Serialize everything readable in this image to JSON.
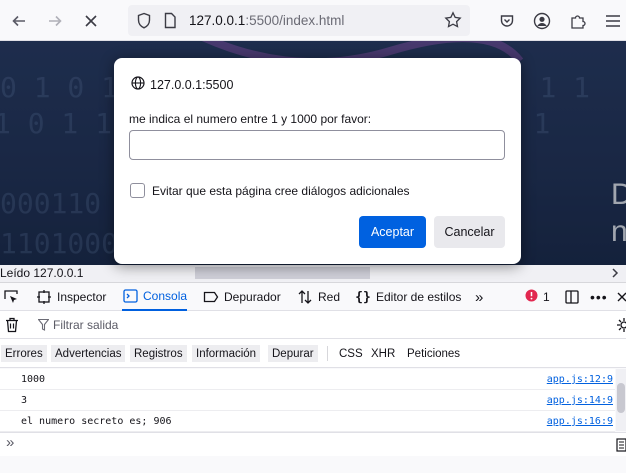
{
  "browser": {
    "url_host": "127.0.0.1",
    "url_rest": ":5500/index.html",
    "icons": [
      "back-arrow-icon",
      "forward-arrow-icon",
      "stop-loading-icon",
      "shield-icon",
      "page-info-icon",
      "star-icon",
      "pocket-icon",
      "account-icon",
      "extensions-icon",
      "menu-icon"
    ]
  },
  "page": {
    "letter_1": "D",
    "letter_2": "n",
    "status_text": "Leído 127.0.0.1"
  },
  "dialog": {
    "origin": "127.0.0.1:5500",
    "message": "me indica el numero entre 1 y 1000 por favor:",
    "input_value": "",
    "checkbox_label": "Evitar que esta página cree diálogos adicionales",
    "accept_label": "Aceptar",
    "cancel_label": "Cancelar"
  },
  "devtools": {
    "tabs": {
      "inspector": "Inspector",
      "console": "Consola",
      "debugger": "Depurador",
      "network": "Red",
      "style_editor": "Editor de estilos"
    },
    "error_count": "1",
    "filter_placeholder": "Filtrar salida",
    "categories": {
      "errors": "Errores",
      "warnings": "Advertencias",
      "logs": "Registros",
      "info": "Información",
      "debug": "Depurar",
      "css": "CSS",
      "xhr": "XHR",
      "requests": "Peticiones"
    },
    "logs": [
      {
        "message": "1000",
        "source": "app.js:12:9"
      },
      {
        "message": "3",
        "source": "app.js:14:9"
      },
      {
        "message": "el numero secreto es; 906",
        "source": "app.js:16:9"
      }
    ],
    "prompt": "»"
  },
  "colors": {
    "accent": "#0060df",
    "primary_button": "#0061e0",
    "error": "#e22850"
  }
}
